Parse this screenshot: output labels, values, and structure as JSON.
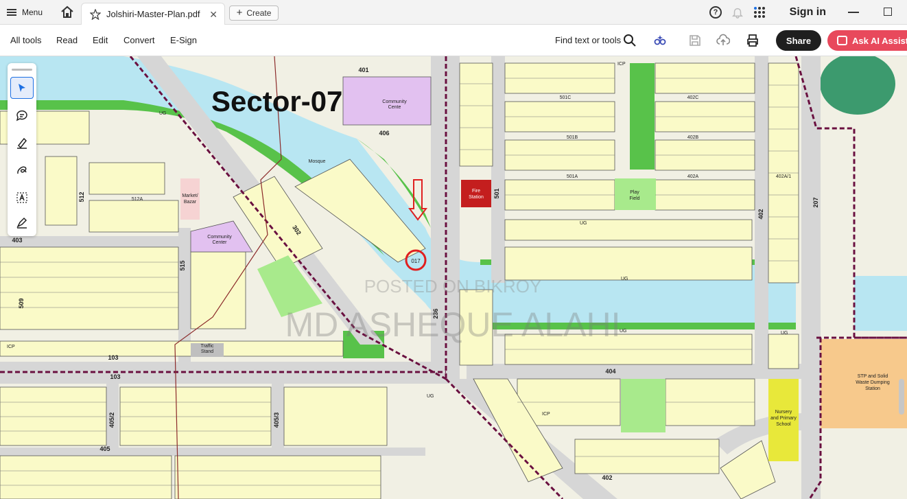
{
  "tabbar": {
    "menu_label": "Menu",
    "doc_tab_title": "Jolshiri-Master-Plan.pdf",
    "create_label": "Create",
    "sign_in_label": "Sign in"
  },
  "toolbar": {
    "items": [
      "All tools",
      "Read",
      "Edit",
      "Convert",
      "E-Sign"
    ],
    "find_text": "Find text or tools",
    "share_label": "Share",
    "ai_label": "Ask AI Assista"
  },
  "map": {
    "title": "Sector-07",
    "watermark_1": "POSTED ON BIKROY",
    "watermark_2": "MD ASHEQUE ALAHI",
    "labels": {
      "community_centre_top": "Community",
      "community_centre_top_2": "Cente",
      "community_center_mid": "Community",
      "community_center_mid_2": "Center",
      "play_field": "Play",
      "play_field_2": "Field",
      "stp_1": "STP and Solid",
      "stp_2": "Waste Dumping",
      "stp_3": "Station",
      "school_1": "Nursery",
      "school_2": "and Primary",
      "school_3": "School",
      "fire_1": "Fire",
      "fire_2": "Station",
      "traffic_1": "Traffic",
      "traffic_2": "Stand",
      "market_1": "Market/",
      "market_2": "Bazar",
      "mosque": "Mosque",
      "road_401": "401",
      "road_403": "403",
      "road_404": "404",
      "road_405": "405",
      "road_405_2": "405/2",
      "road_405_3": "405/3",
      "road_406": "406",
      "road_103": "103",
      "road_402": "402",
      "road_501": "501",
      "road_512": "512",
      "road_515": "515",
      "road_509": "509",
      "road_207": "207",
      "road_236": "236",
      "road_302": "302",
      "block_501c": "501C",
      "block_501b": "501B",
      "block_501a": "501A",
      "block_402c": "402C",
      "block_402b": "402B",
      "block_402a": "402A",
      "block_512a": "512A",
      "block_402a1": "402A/1",
      "ug": "UG",
      "icp": "ICP",
      "plot_marked": "017"
    }
  },
  "colors": {
    "accent_ai": "#e8495c",
    "plot_fill": "#fafac8",
    "water": "#b8e6f2",
    "green": "#58c24a",
    "road": "#d6d6d6",
    "boundary": "#6a1040",
    "stp": "#f7c98c",
    "community": "#e2c1f0",
    "marker_red": "#e02020"
  },
  "icons": [
    "hamburger-icon",
    "home-icon",
    "star-icon",
    "close-icon",
    "plus-icon",
    "help-icon",
    "bell-icon",
    "apps-icon",
    "minimize-icon",
    "restore-icon",
    "search-icon",
    "ai-tools-icon",
    "save-icon",
    "upload-icon",
    "print-icon",
    "cursor-icon",
    "comment-icon",
    "highlight-icon",
    "draw-icon",
    "text-select-icon",
    "sign-icon"
  ]
}
